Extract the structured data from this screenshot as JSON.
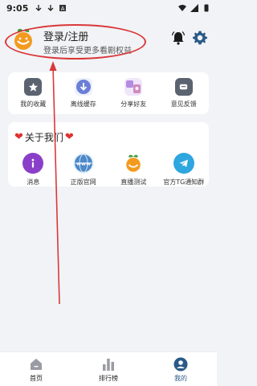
{
  "status_bar": {
    "time": "9:05"
  },
  "header": {
    "login_title": "登录/注册",
    "login_subtitle": "登录后享受更多看剧权益"
  },
  "quick_menu": [
    {
      "label": "我的收藏",
      "icon": "star-icon"
    },
    {
      "label": "离线缓存",
      "icon": "download-icon"
    },
    {
      "label": "分享好友",
      "icon": "share-icon"
    },
    {
      "label": "意见反馈",
      "icon": "feedback-icon"
    }
  ],
  "about": {
    "title": "关于我们",
    "items": [
      {
        "label": "消息",
        "icon": "info-icon"
      },
      {
        "label": "正版官网",
        "icon": "www-icon"
      },
      {
        "label": "直播测试",
        "icon": "orange-logo-icon"
      },
      {
        "label": "官方TG通知群",
        "icon": "telegram-icon"
      }
    ]
  },
  "bottom_nav": [
    {
      "label": "首页",
      "icon": "home-icon"
    },
    {
      "label": "排行榜",
      "icon": "ranking-icon"
    },
    {
      "label": "我的",
      "icon": "profile-icon"
    }
  ],
  "colors": {
    "accent": "#2a5a86",
    "annotation_red": "#d9383a",
    "background": "#f2f3f6"
  }
}
